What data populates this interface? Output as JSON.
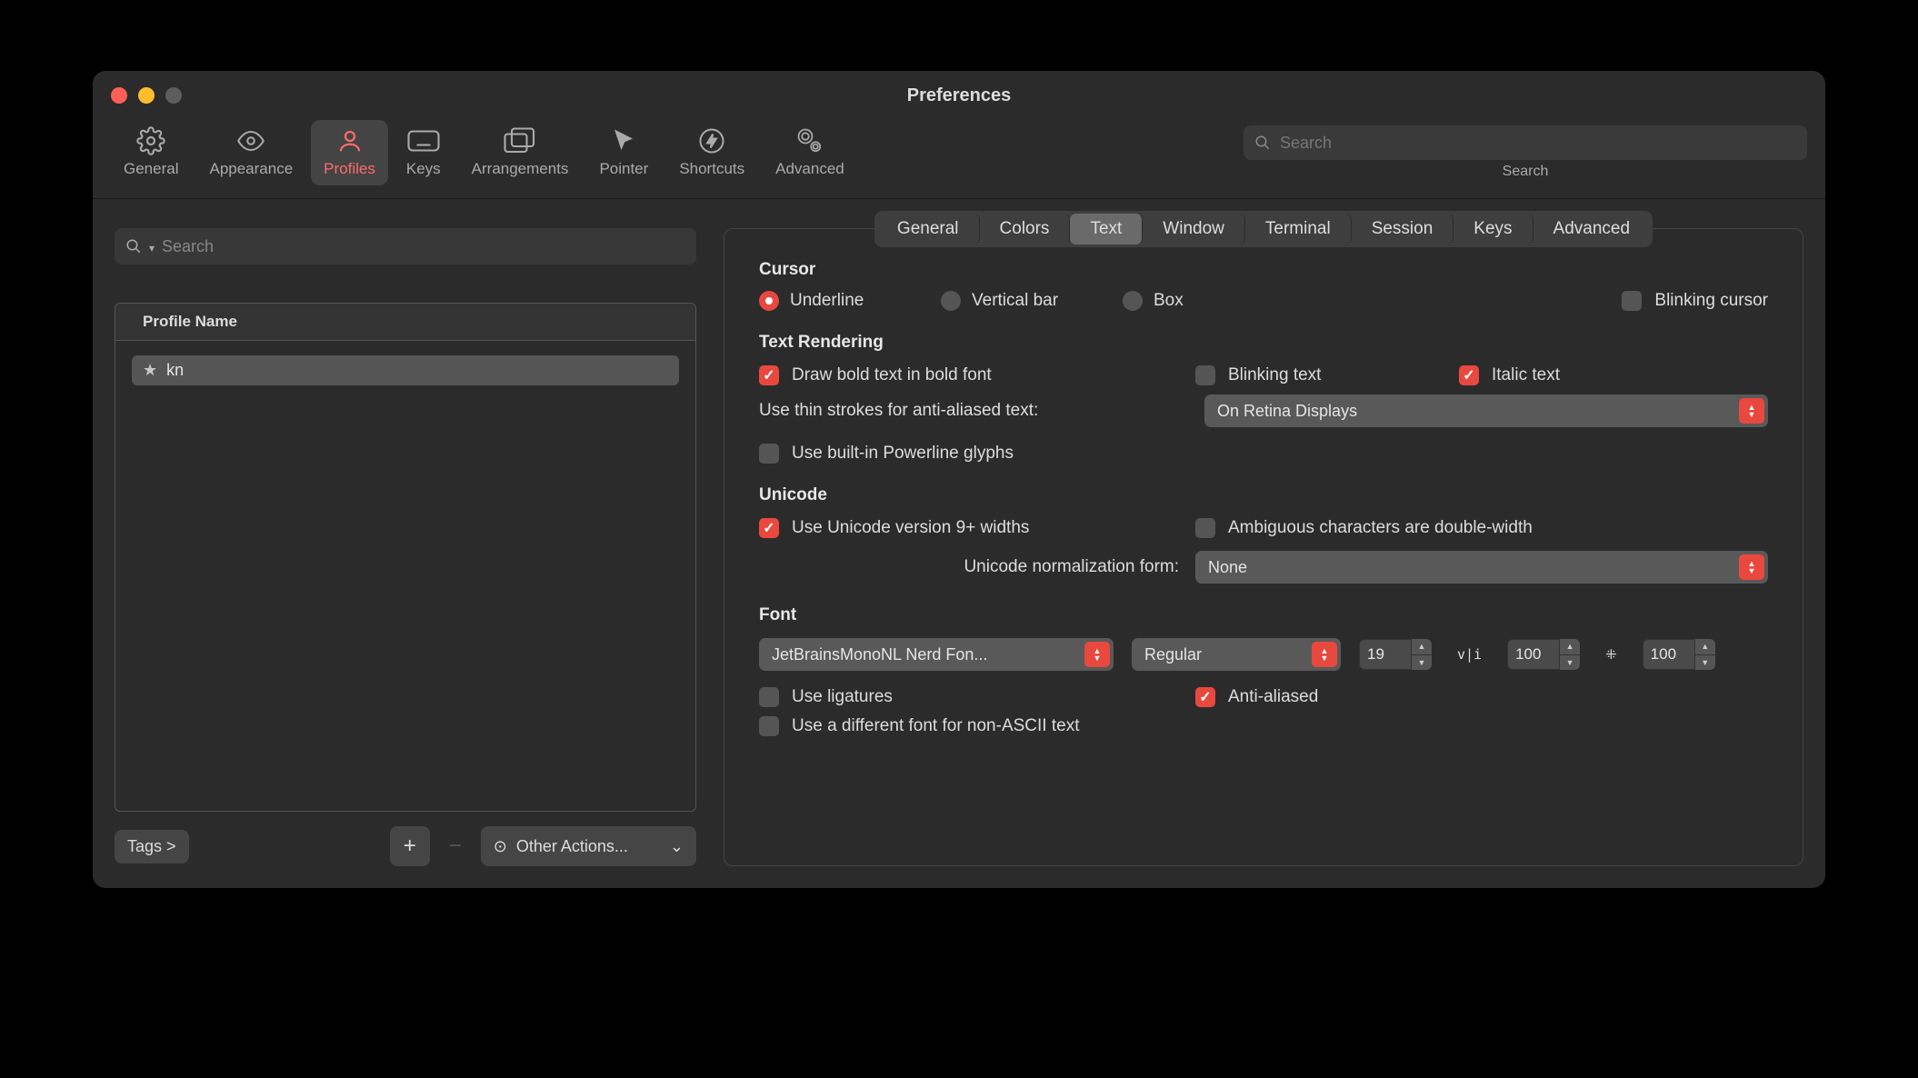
{
  "window": {
    "title": "Preferences"
  },
  "toolbar": {
    "items": [
      {
        "label": "General"
      },
      {
        "label": "Appearance"
      },
      {
        "label": "Profiles"
      },
      {
        "label": "Keys"
      },
      {
        "label": "Arrangements"
      },
      {
        "label": "Pointer"
      },
      {
        "label": "Shortcuts"
      },
      {
        "label": "Advanced"
      }
    ],
    "search_placeholder": "Search",
    "search_label": "Search"
  },
  "sidebar": {
    "search_placeholder": "Search",
    "header": "Profile Name",
    "profiles": [
      {
        "name": "kn"
      }
    ],
    "tags_label": "Tags >",
    "other_actions": "Other Actions..."
  },
  "tabs": [
    "General",
    "Colors",
    "Text",
    "Window",
    "Terminal",
    "Session",
    "Keys",
    "Advanced"
  ],
  "cursor": {
    "title": "Cursor",
    "underline": "Underline",
    "vertical": "Vertical bar",
    "box": "Box",
    "blinking": "Blinking cursor"
  },
  "text_rendering": {
    "title": "Text Rendering",
    "bold": "Draw bold text in bold font",
    "blinking": "Blinking text",
    "italic": "Italic text",
    "thin_label": "Use thin strokes for anti-aliased text:",
    "thin_value": "On Retina Displays",
    "powerline": "Use built-in Powerline glyphs"
  },
  "unicode": {
    "title": "Unicode",
    "v9": "Use Unicode version 9+ widths",
    "ambiguous": "Ambiguous characters are double-width",
    "norm_label": "Unicode normalization form:",
    "norm_value": "None"
  },
  "font": {
    "title": "Font",
    "family": "JetBrainsMonoNL Nerd Fon...",
    "weight": "Regular",
    "size": "19",
    "h_spacing": "100",
    "v_spacing": "100",
    "ligatures": "Use ligatures",
    "antialiased": "Anti-aliased",
    "different_font": "Use a different font for non-ASCII text"
  }
}
